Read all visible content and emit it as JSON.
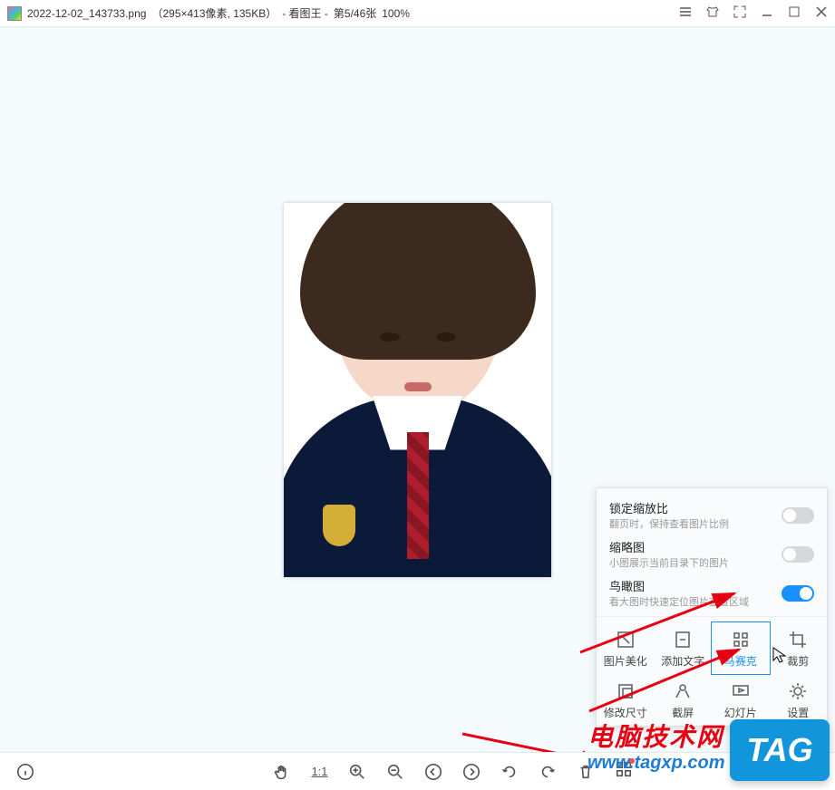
{
  "title": {
    "filename": "2022-12-02_143733.png",
    "dimensions": "（295×413像素, 135KB）",
    "app": "- 看图王 -",
    "position": "第5/46张",
    "zoom": "100%"
  },
  "side_panel": {
    "toggles": [
      {
        "title": "锁定缩放比",
        "subtitle": "翻页时，保持查看图片比例",
        "on": false
      },
      {
        "title": "缩略图",
        "subtitle": "小图展示当前目录下的图片",
        "on": false
      },
      {
        "title": "鸟瞰图",
        "subtitle": "看大图时快速定位图片查看区域",
        "on": true
      }
    ],
    "tools_row1": [
      {
        "name": "beautify",
        "label": "图片美化"
      },
      {
        "name": "add-text",
        "label": "添加文字"
      },
      {
        "name": "mosaic",
        "label": "马赛克"
      },
      {
        "name": "crop",
        "label": "裁剪"
      }
    ],
    "tools_row2": [
      {
        "name": "resize",
        "label": "修改尺寸"
      },
      {
        "name": "screenshot",
        "label": "截屏"
      },
      {
        "name": "slideshow",
        "label": "幻灯片"
      },
      {
        "name": "settings",
        "label": "设置"
      }
    ]
  },
  "bottom": {
    "ratio": "1:1"
  },
  "watermark": {
    "text": "电脑技术网",
    "url": "www.tagxp.com",
    "tag": "TAG"
  }
}
